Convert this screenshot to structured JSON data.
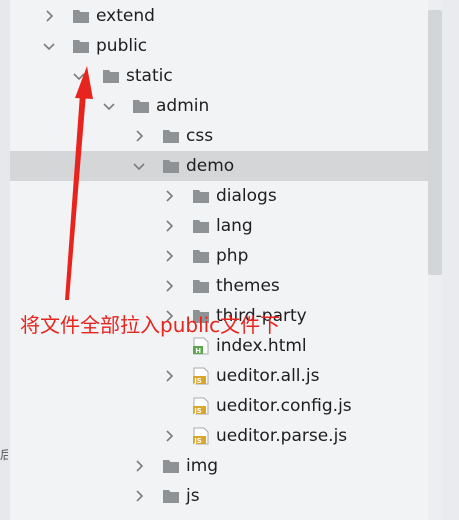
{
  "tree": {
    "items": [
      {
        "label": "extend",
        "depth": 0,
        "expanded": false,
        "type": "folder"
      },
      {
        "label": "public",
        "depth": 0,
        "expanded": true,
        "type": "folder"
      },
      {
        "label": "static",
        "depth": 1,
        "expanded": true,
        "type": "folder"
      },
      {
        "label": "admin",
        "depth": 2,
        "expanded": true,
        "type": "folder"
      },
      {
        "label": "css",
        "depth": 3,
        "expanded": false,
        "type": "folder"
      },
      {
        "label": "demo",
        "depth": 3,
        "expanded": true,
        "type": "folder",
        "selected": true
      },
      {
        "label": "dialogs",
        "depth": 4,
        "expanded": false,
        "type": "folder"
      },
      {
        "label": "lang",
        "depth": 4,
        "expanded": false,
        "type": "folder"
      },
      {
        "label": "php",
        "depth": 4,
        "expanded": false,
        "type": "folder"
      },
      {
        "label": "themes",
        "depth": 4,
        "expanded": false,
        "type": "folder"
      },
      {
        "label": "third-party",
        "depth": 4,
        "expanded": false,
        "type": "folder"
      },
      {
        "label": "index.html",
        "depth": 4,
        "type": "html-file",
        "icon_letter": "H"
      },
      {
        "label": "ueditor.all.js",
        "depth": 4,
        "expanded": false,
        "type": "js-file",
        "icon_letter": "JS"
      },
      {
        "label": "ueditor.config.js",
        "depth": 4,
        "type": "js-file",
        "icon_letter": "JS"
      },
      {
        "label": "ueditor.parse.js",
        "depth": 4,
        "expanded": false,
        "type": "js-file",
        "icon_letter": "JS"
      },
      {
        "label": "img",
        "depth": 3,
        "expanded": false,
        "type": "folder"
      },
      {
        "label": "js",
        "depth": 3,
        "expanded": false,
        "type": "folder"
      }
    ]
  },
  "annotation": {
    "text": "将文件全部拉入public文件下",
    "color": "#e8241f"
  },
  "edge_glyph": "后"
}
